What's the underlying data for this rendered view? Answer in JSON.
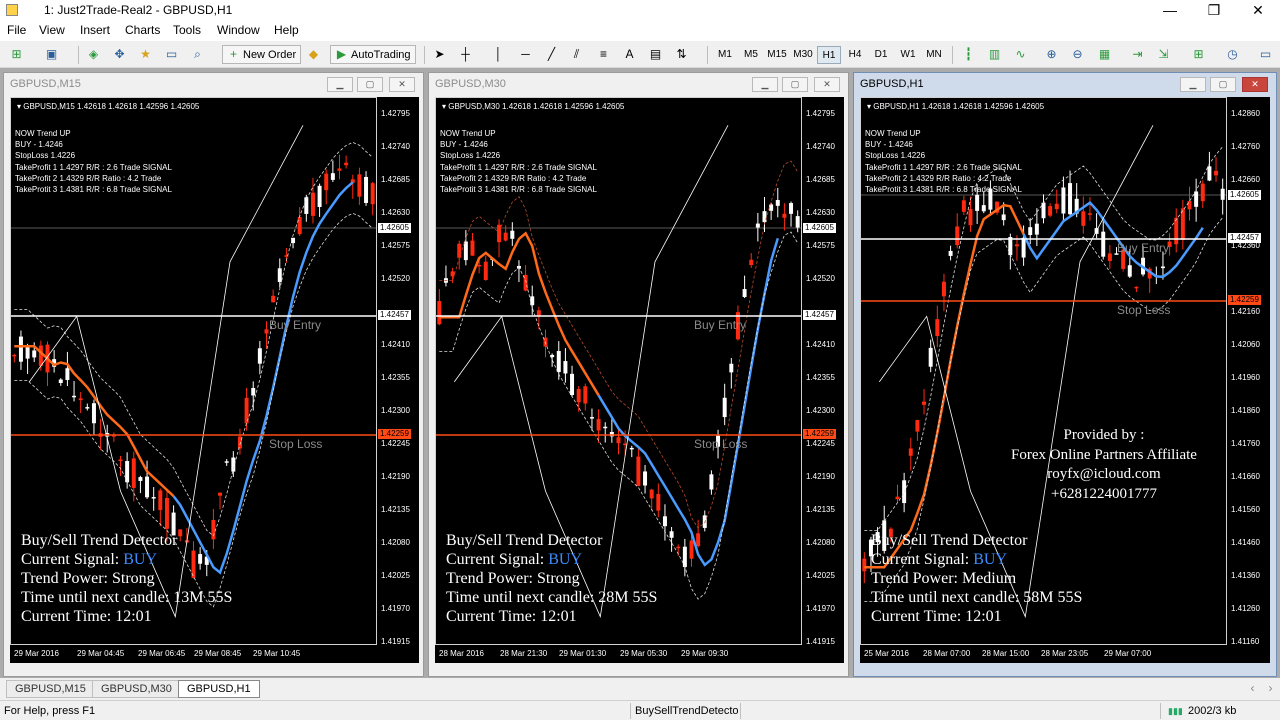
{
  "window": {
    "title": "1: Just2Trade-Real2 - GBPUSD,H1",
    "controls": [
      "—",
      "❐",
      "✕"
    ]
  },
  "menu": [
    "File",
    "View",
    "Insert",
    "Charts",
    "Tools",
    "Window",
    "Help"
  ],
  "toolbar": {
    "new_order": "New Order",
    "autotrading": "AutoTrading",
    "draw_text": "A",
    "timeframes": [
      "M1",
      "M5",
      "M15",
      "M30",
      "H1",
      "H4",
      "D1",
      "W1",
      "MN"
    ],
    "active_timeframe": "H1"
  },
  "common": {
    "header_values": "1.42618 1.42618 1.42596 1.42605",
    "info": [
      "NOW Trend   UP",
      "BUY - 1.4246",
      "StopLoss 1.4226",
      "TakeProfit 1 1.4297 R/R : 2.6  Trade SIGNAL",
      "TakeProfit 2 1.4329 R/R Ratio : 4.2 Trade",
      "TakeProtit 3 1.4381 R/R : 6.8 Trade SIGNAL"
    ],
    "panel_title": "Buy/Sell Trend Detector",
    "panel_signal_label": "Current Signal: ",
    "panel_signal": "BUY",
    "panel_time_label": "Current Time: 12:01",
    "buy_entry": "Buy Entry",
    "stop_loss": "Stop Loss",
    "current_price": "1.42605",
    "entry_price": "1.42457",
    "stop_price": "1.42259",
    "colors": {
      "signal": "#3d8cff",
      "ma": "#ff6a1a",
      "trend": "#4a9bff",
      "stop": "#ff4a16"
    }
  },
  "charts": [
    {
      "title": "GBPUSD,M15",
      "header_symbol": "GBPUSD,M15",
      "power": "Trend Power: Strong",
      "next_candle": "Time until next candle: 13M 55S",
      "prices": [
        "1.42795",
        "1.42740",
        "1.42685",
        "1.42630",
        "1.42575",
        "1.42520",
        "1.42410",
        "1.42355",
        "1.42300",
        "1.42245",
        "1.42190",
        "1.42135",
        "1.42080",
        "1.42025",
        "1.41970",
        "1.41915"
      ],
      "times": [
        "29 Mar 2016",
        "29 Mar 04:45",
        "29 Mar 06:45",
        "29 Mar 08:45",
        "29 Mar 10:45"
      ]
    },
    {
      "title": "GBPUSD,M30",
      "header_symbol": "GBPUSD,M30",
      "power": "Trend Power: Strong",
      "next_candle": "Time until next candle: 28M 55S",
      "prices": [
        "1.42795",
        "1.42740",
        "1.42685",
        "1.42630",
        "1.42575",
        "1.42520",
        "1.42410",
        "1.42355",
        "1.42300",
        "1.42245",
        "1.42190",
        "1.42135",
        "1.42080",
        "1.42025",
        "1.41970",
        "1.41915"
      ],
      "times": [
        "28 Mar 2016",
        "28 Mar 21:30",
        "29 Mar 01:30",
        "29 Mar 05:30",
        "29 Mar 09:30"
      ]
    },
    {
      "title": "GBPUSD,H1",
      "header_symbol": "GBPUSD,H1",
      "power": "Trend Power: Medium",
      "next_candle": "Time until next candle: 58M 55S",
      "prices": [
        "1.42860",
        "1.42760",
        "1.42660",
        "1.42360",
        "1.42160",
        "1.42060",
        "1.41960",
        "1.41860",
        "1.41760",
        "1.41660",
        "1.41560",
        "1.41460",
        "1.41360",
        "1.41260",
        "1.41160"
      ],
      "times": [
        "25 Mar 2016",
        "28 Mar 07:00",
        "28 Mar 15:00",
        "28 Mar 23:05",
        "29 Mar 07:00"
      ]
    }
  ],
  "provided": [
    "Provided by :",
    "Forex Online Partners Affiliate",
    "royfx@icloud.com",
    "+6281224001777"
  ],
  "tabs": [
    "GBPUSD,M15",
    "GBPUSD,M30",
    "GBPUSD,H1"
  ],
  "status": {
    "help": "For Help, press F1",
    "indicator": "BuySellTrendDetecto",
    "traffic": "2002/3 kb"
  }
}
